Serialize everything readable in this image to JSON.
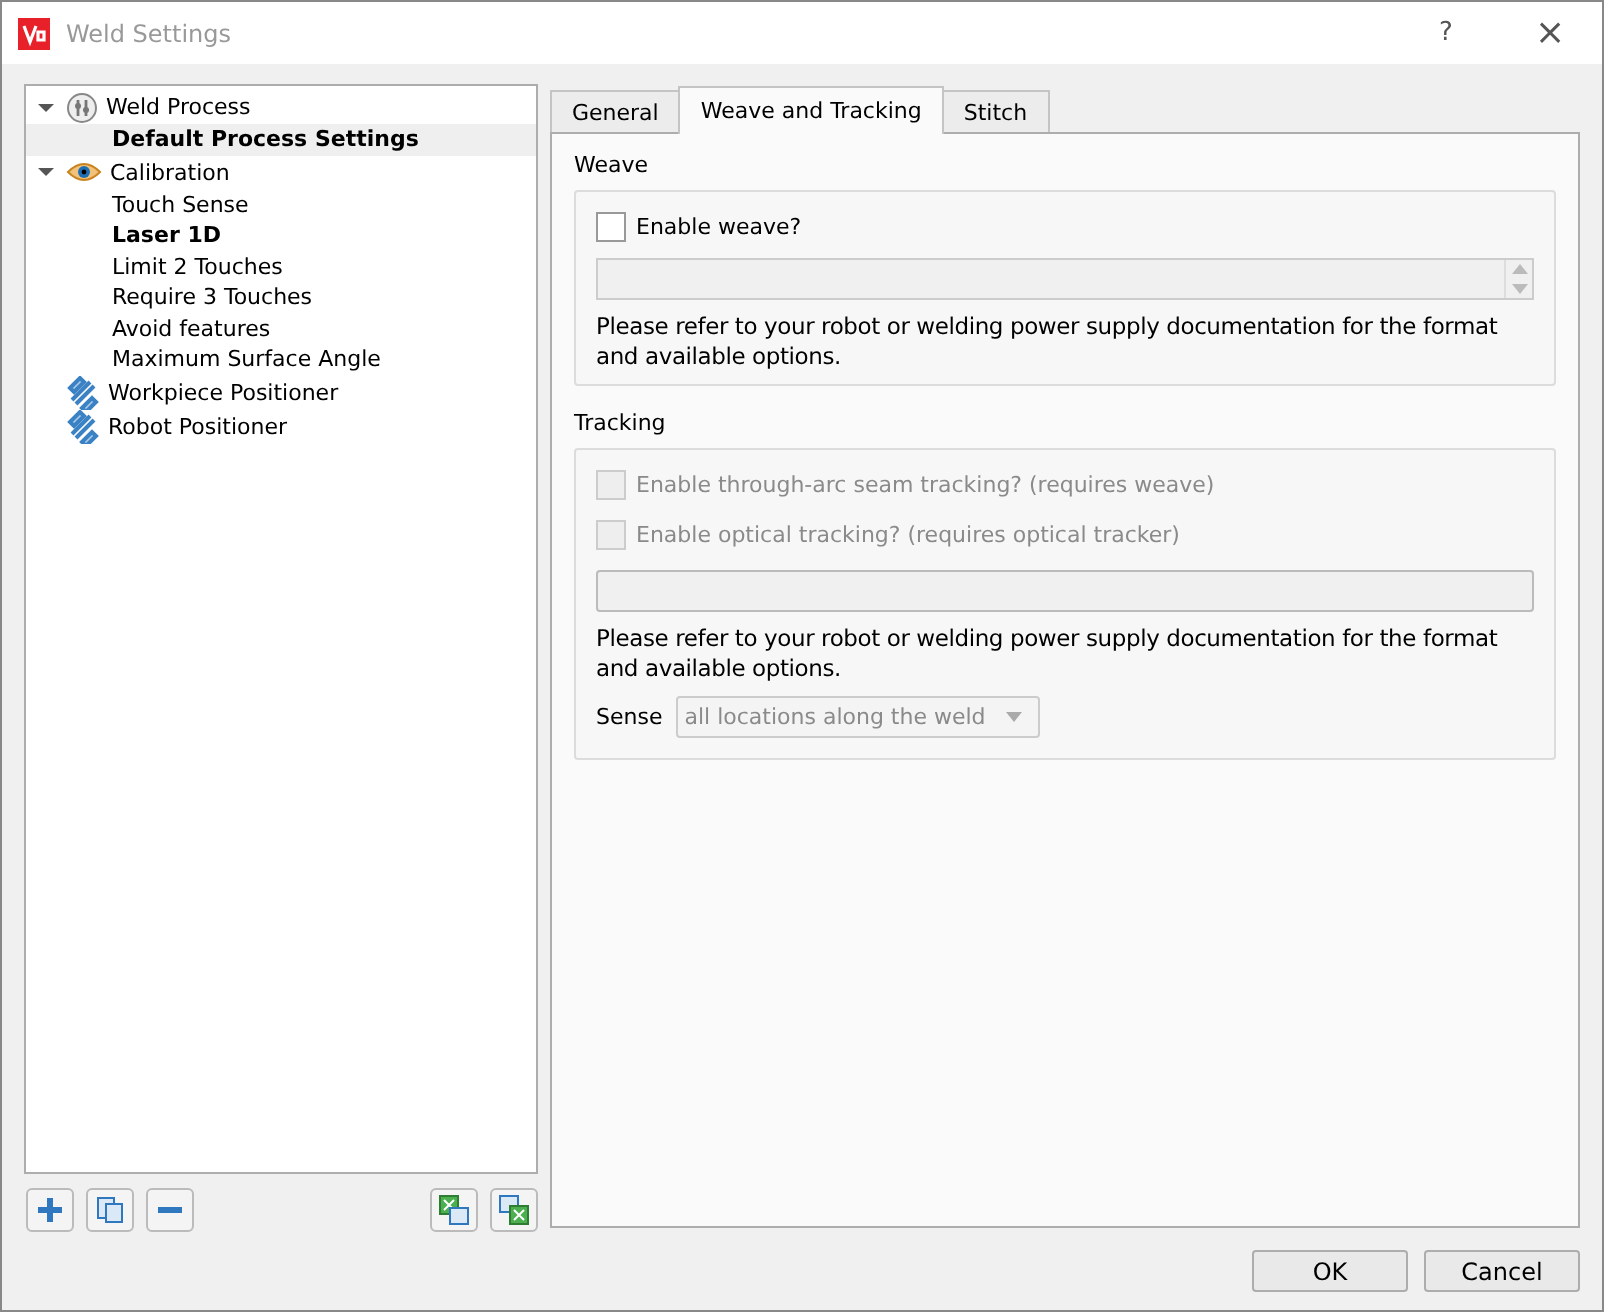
{
  "window": {
    "title": "Weld Settings",
    "help": "?",
    "close": "×"
  },
  "tree": [
    {
      "label": "Weld Process",
      "kind": "process",
      "expanded": true,
      "children": [
        {
          "label": "Default Process Settings",
          "selected": true,
          "bold": true
        }
      ]
    },
    {
      "label": "Calibration",
      "kind": "eye",
      "expanded": true,
      "children": [
        {
          "label": "Touch Sense",
          "selected": false,
          "bold": false
        },
        {
          "label": "Laser 1D",
          "selected": false,
          "bold": true
        },
        {
          "label": "Limit 2 Touches",
          "selected": false,
          "bold": false
        },
        {
          "label": "Require 3 Touches",
          "selected": false,
          "bold": false
        },
        {
          "label": "Avoid features",
          "selected": false,
          "bold": false
        },
        {
          "label": "Maximum Surface Angle",
          "selected": false,
          "bold": false
        }
      ]
    },
    {
      "label": "Workpiece Positioner",
      "kind": "positioner"
    },
    {
      "label": "Robot Positioner",
      "kind": "positioner"
    }
  ],
  "tabs": [
    {
      "label": "General",
      "selected": false
    },
    {
      "label": "Weave and Tracking",
      "selected": true
    },
    {
      "label": "Stitch",
      "selected": false
    }
  ],
  "weave": {
    "title": "Weave",
    "checkbox": {
      "label": "Enable weave?",
      "checked": false,
      "disabled": false
    },
    "note": "Please refer to your robot or welding power supply documentation for the format and available options."
  },
  "tracking": {
    "title": "Tracking",
    "checkboxes": [
      {
        "label": "Enable through-arc seam tracking? (requires weave)",
        "checked": false,
        "disabled": true
      },
      {
        "label": "Enable optical tracking? (requires optical tracker)",
        "checked": false,
        "disabled": true
      }
    ],
    "note": "Please refer to your robot or welding power supply documentation for the format and available options.",
    "sense_label": "Sense",
    "sense_value": "all locations along the weld"
  },
  "buttons": [
    "OK",
    "Cancel"
  ]
}
